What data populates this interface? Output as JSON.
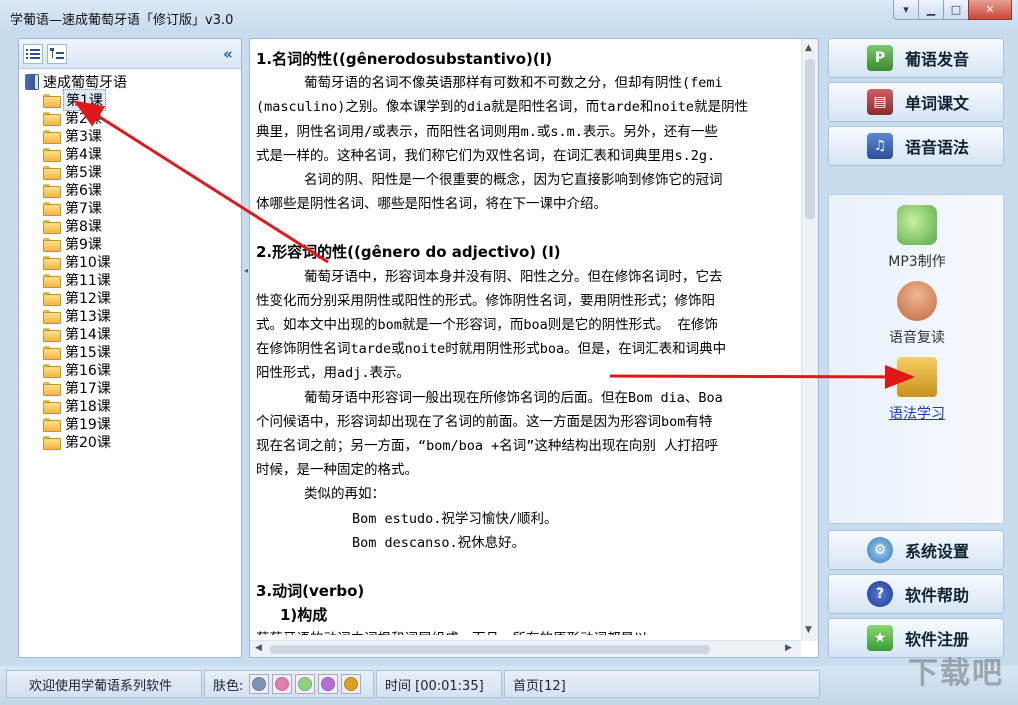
{
  "window": {
    "title": "学葡语—速成葡萄牙语「修订版」v3.0",
    "buttons": {
      "menu": "▾",
      "minimize": "▁",
      "maximize": "□",
      "close": "✕"
    }
  },
  "tree": {
    "root": "速成葡萄牙语",
    "lessons": [
      "第1课",
      "第2课",
      "第3课",
      "第4课",
      "第5课",
      "第6课",
      "第7课",
      "第8课",
      "第9课",
      "第10课",
      "第11课",
      "第12课",
      "第13课",
      "第14课",
      "第15课",
      "第16课",
      "第17课",
      "第18课",
      "第19课",
      "第20课"
    ],
    "selected_index": 0,
    "collapse_label": "«"
  },
  "content": {
    "lines": [
      {
        "cls": "h",
        "text": "1.名词的性((gênerodosubstantivo)(I)"
      },
      {
        "cls": "ind1",
        "text": "葡萄牙语的名词不像英语那样有可数和不可数之分，但却有阴性(femi"
      },
      {
        "cls": "",
        "text": "(masculino)之别。像本课学到的dia就是阳性名词，而tarde和noite就是阴性"
      },
      {
        "cls": "",
        "text": "典里，阴性名词用/或表示，而阳性名词则用m.或s.m.表示。另外，还有一些"
      },
      {
        "cls": "",
        "text": "式是一样的。这种名词，我们称它们为双性名词，在词汇表和词典里用s.2g."
      },
      {
        "cls": "ind1",
        "text": "名词的阴、阳性是一个很重要的概念，因为它直接影响到修饰它的冠词"
      },
      {
        "cls": "",
        "text": "体哪些是阴性名词、哪些是阳性名词，将在下一课中介绍。"
      },
      {
        "cls": "gap",
        "text": ""
      },
      {
        "cls": "h",
        "text": "2.形容词的性((gênero do adjectivo) (I)"
      },
      {
        "cls": "ind1",
        "text": "葡萄牙语中，形容词本身并没有阴、阳性之分。但在修饰名词时，它去"
      },
      {
        "cls": "",
        "text": "性变化而分别采用阴性或阳性的形式。修饰阴性名词，要用阴性形式；修饰阳"
      },
      {
        "cls": "",
        "text": "式。如本文中出现的bom就是一个形容词，而boa则是它的阴性形式。 在修饰"
      },
      {
        "cls": "",
        "text": "在修饰阴性名词tarde或noite时就用阴性形式boa。但是，在词汇表和词典中"
      },
      {
        "cls": "",
        "text": "阳性形式，用adj.表示。"
      },
      {
        "cls": "ind1",
        "text": "葡萄牙语中形容词一般出现在所修饰名词的后面。但在Bom dia、Boa"
      },
      {
        "cls": "",
        "text": "个问候语中，形容词却出现在了名词的前面。这一方面是因为形容词bom有特"
      },
      {
        "cls": "",
        "text": "现在名词之前；另一方面，“bom/boa +名词”这种结构出现在向别 人打招呼"
      },
      {
        "cls": "",
        "text": "时候，是一种固定的格式。"
      },
      {
        "cls": "ind1",
        "text": "类似的再如："
      },
      {
        "cls": "ind2",
        "text": "Bom estudo.祝学习愉快/顺利。"
      },
      {
        "cls": "ind2",
        "text": "Bom descanso.祝休息好。"
      },
      {
        "cls": "gap",
        "text": ""
      },
      {
        "cls": "h",
        "text": "3.动词(verbo)"
      },
      {
        "cls": "sub",
        "text": "1)构成"
      },
      {
        "cls": "",
        "text": "葡萄牙语的动词由词根和词尾组成。而且，所有的原形动词都是以-ar、-"
      }
    ]
  },
  "nav": {
    "pronunciation": "葡语发音",
    "vocab": "单词课文",
    "grammar": "语音语法",
    "settings": "系统设置",
    "help": "软件帮助",
    "register": "软件注册",
    "icon_letters": {
      "pronunciation": "P"
    }
  },
  "subtools": {
    "mp3": "MP3制作",
    "repeat": "语音复读",
    "grammar_study": "语法学习"
  },
  "status": {
    "welcome": "欢迎使用学葡语系列软件",
    "skin_label": "肤色:",
    "time": "时间 [00:01:35]",
    "page": "首页[12]",
    "skin_colors": [
      "#7d95b7",
      "#e080b0",
      "#90d080",
      "#b070d0",
      "#d8a020"
    ]
  },
  "watermark": "下载吧",
  "colors": {
    "accent": "#1a3fc0",
    "arrow": "#e01818"
  }
}
